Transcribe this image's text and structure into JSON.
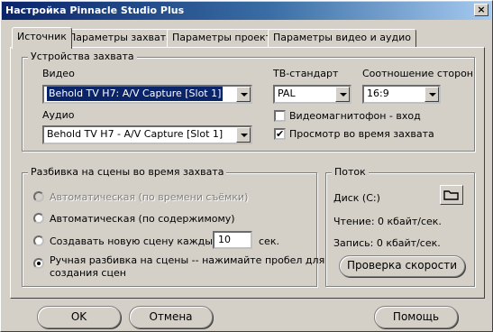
{
  "window": {
    "title": "Настройка Pinnacle Studio Plus"
  },
  "tabs": [
    {
      "label": "Источник",
      "active": true
    },
    {
      "label": "Параметры захвата",
      "active": false
    },
    {
      "label": "Параметры проекта",
      "active": false
    },
    {
      "label": "Параметры видео и аудио",
      "active": false
    }
  ],
  "capture_devices": {
    "title": "Устройства захвата",
    "video_label": "Видео",
    "video_value": "Behold TV H7: A/V Capture [Slot 1]",
    "audio_label": "Аудио",
    "audio_value": "Behold TV H7 - A/V Capture [Slot 1]",
    "tv_standard_label": "ТВ-стандарт",
    "tv_standard_value": "PAL",
    "aspect_label": "Соотношение сторон",
    "aspect_value": "16:9",
    "vcr_input_label": "Видеомагнитофон - вход",
    "vcr_input_checked": false,
    "preview_label": "Просмотр во время захвата",
    "preview_checked": true
  },
  "scene_detection": {
    "title": "Разбивка на сцены во время захвата",
    "options": [
      {
        "label": "Автоматическая (по времени съёмки)",
        "selected": false,
        "disabled": true
      },
      {
        "label": "Автоматическая (по содержимому)",
        "selected": false,
        "disabled": false
      },
      {
        "label": "Создавать новую сцену каждые",
        "selected": false,
        "disabled": false
      },
      {
        "label_line1": "Ручная разбивка на сцены -- нажимайте пробел для",
        "label_line2": "создания сцен",
        "selected": true,
        "disabled": false
      }
    ],
    "interval_value": "10",
    "interval_unit": "сек."
  },
  "stream": {
    "title": "Поток",
    "disk_label": "Диск (C:)",
    "read_label": "Чтение: 0 кбайт/сек.",
    "write_label": "Запись: 0 кбайт/сек.",
    "speed_test_button": "Проверка скорости",
    "folder_icon": "folder-icon"
  },
  "footer": {
    "ok_label": "OK",
    "cancel_label": "Отмена",
    "help_label": "Помощь"
  }
}
